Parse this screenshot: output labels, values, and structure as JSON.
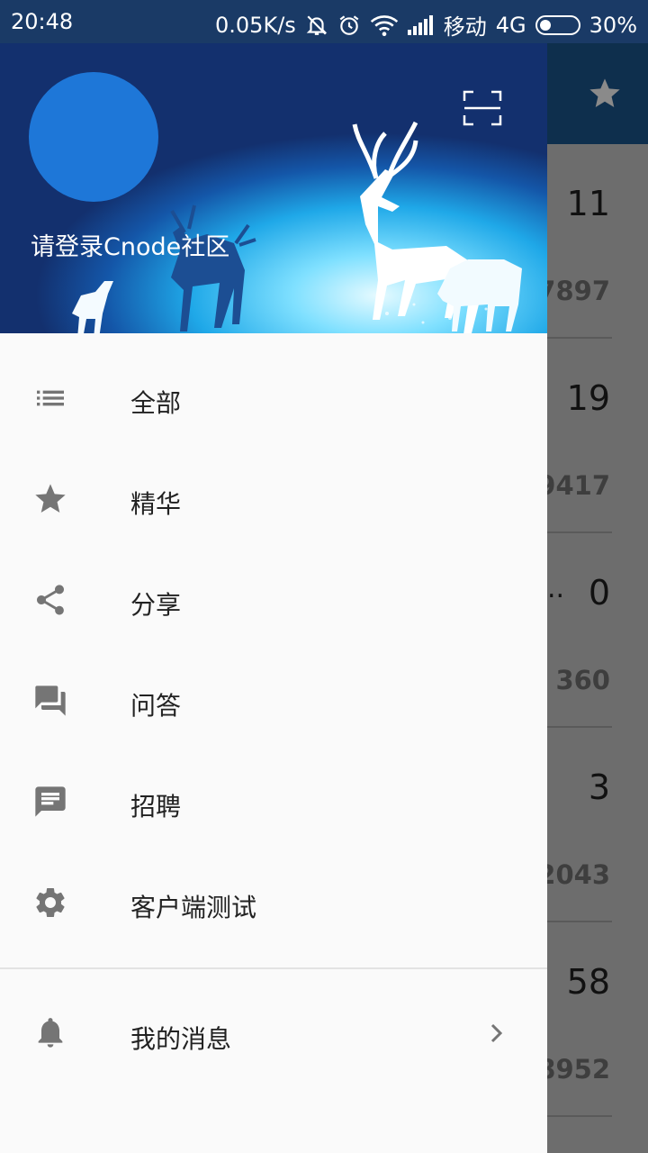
{
  "status_bar": {
    "time": "20:48",
    "network_speed": "0.05K/s",
    "carrier": "移动",
    "network_type": "4G",
    "battery": "30%",
    "battery_level": 0.3
  },
  "background": {
    "rows": [
      {
        "count": "11",
        "views": "7897"
      },
      {
        "count": "19",
        "views": "9417"
      },
      {
        "count": "0",
        "views": "360",
        "title_tail": ".."
      },
      {
        "count": "3",
        "views": "2043"
      },
      {
        "count": "58",
        "views": "8952"
      }
    ]
  },
  "drawer": {
    "login_text": "请登录Cnode社区",
    "menu": [
      {
        "label": "全部",
        "icon": "list-icon"
      },
      {
        "label": "精华",
        "icon": "star-icon"
      },
      {
        "label": "分享",
        "icon": "share-icon"
      },
      {
        "label": "问答",
        "icon": "forum-icon"
      },
      {
        "label": "招聘",
        "icon": "message-icon"
      },
      {
        "label": "客户端测试",
        "icon": "settings-icon"
      }
    ],
    "messages": {
      "label": "我的消息",
      "icon": "bell-icon"
    }
  },
  "colors": {
    "avatar": "#1e77d8",
    "toolbar": "#0e2f4d",
    "icon_gray": "#757575"
  }
}
